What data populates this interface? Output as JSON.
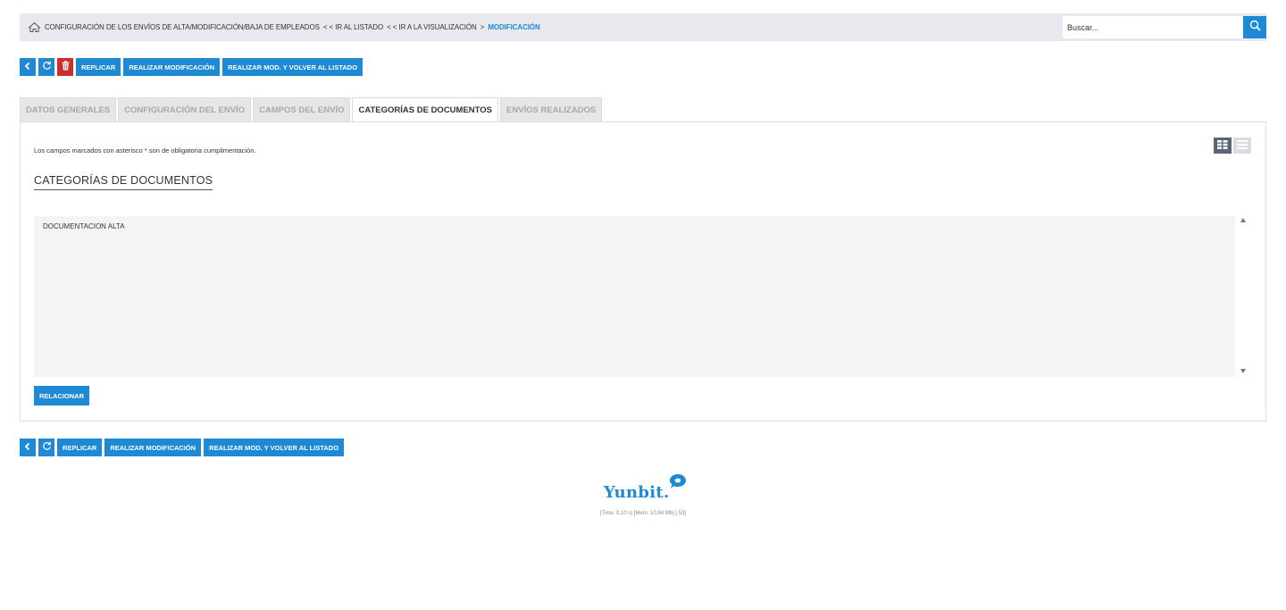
{
  "breadcrumb": {
    "root": "CONFIGURACIÓN DE LOS ENVÍOS DE ALTA/MODIFICACIÓN/BAJA DE EMPLEADOS",
    "link_list": "< < IR AL LISTADO",
    "link_view": "< < IR A LA VISUALIZACIÓN",
    "separator": ">",
    "current": "MODIFICACIÓN"
  },
  "search": {
    "placeholder": "Buscar..."
  },
  "toolbar_top": {
    "replicate": "REPLICAR",
    "modify": "REALIZAR MODIFICACIÓN",
    "modify_return": "REALIZAR MOD. Y VOLVER AL LISTADO"
  },
  "tabs": [
    {
      "label": "DATOS GENERALES",
      "active": false
    },
    {
      "label": "CONFIGURACIÓN DEL ENVÍO",
      "active": false
    },
    {
      "label": "CAMPOS DEL ENVÍO",
      "active": false
    },
    {
      "label": "CATEGORÍAS DE DOCUMENTOS",
      "active": true
    },
    {
      "label": "ENVÍOS REALIZADOS",
      "active": false
    }
  ],
  "panel": {
    "required_note": "Los campos marcados con asterisco * son de obligatoria cumplimentación.",
    "section_title": "CATEGORÍAS DE DOCUMENTOS",
    "list_items": [
      "DOCUMENTACION ALTA"
    ],
    "relate_button": "RELACIONAR"
  },
  "toolbar_bottom": {
    "replicate": "REPLICAR",
    "modify": "REALIZAR MODIFICACIÓN",
    "modify_return": "REALIZAR MOD. Y VOLVER AL LISTADO"
  },
  "footer": {
    "logo_text": "Yunbit.",
    "stats": "[Time: 0,10 s] [Mem: 10,94 Mb] [.53]"
  },
  "colors": {
    "accent": "#1e8ad6",
    "danger": "#c9302c",
    "topbar_bg": "#e8e9ee",
    "listbox_bg": "#f4f4f4"
  },
  "icons": {
    "home": "home-icon",
    "search": "search-icon",
    "back": "chevron-left-icon",
    "refresh": "refresh-icon",
    "delete": "trash-icon",
    "grid_view": "grid-view-icon",
    "list_view": "list-view-icon",
    "logo_bubble": "chat-bubble-icon"
  }
}
